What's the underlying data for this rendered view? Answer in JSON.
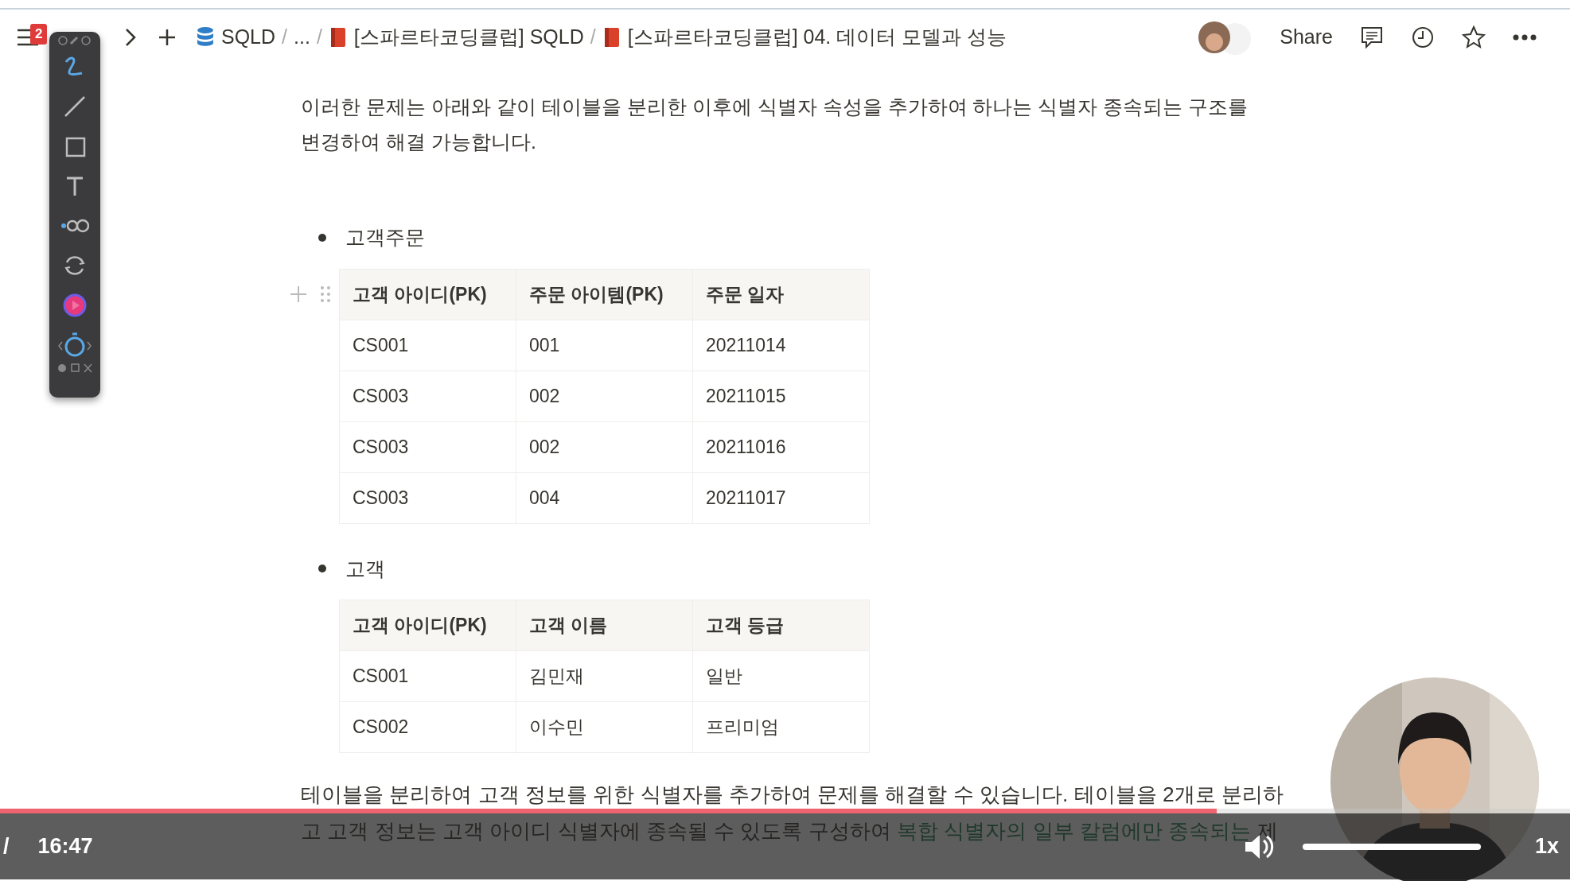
{
  "topbar": {
    "notification_count": "2",
    "breadcrumb": [
      {
        "kind": "database",
        "text": "SQLD"
      },
      {
        "kind": "separator",
        "text": "/"
      },
      {
        "kind": "plain",
        "text": "..."
      },
      {
        "kind": "separator",
        "text": "/"
      },
      {
        "kind": "page",
        "text": "[스파르타코딩클럽] SQLD"
      },
      {
        "kind": "separator",
        "text": "/"
      },
      {
        "kind": "page",
        "text": "[스파르타코딩클럽] 04. 데이터 모델과 성능"
      }
    ],
    "share": "Share"
  },
  "annotation_toolbar": {
    "tools": [
      {
        "kind": "pen",
        "selected": true
      },
      {
        "kind": "line",
        "selected": false
      },
      {
        "kind": "rectangle",
        "selected": false
      },
      {
        "kind": "text",
        "selected": false
      },
      {
        "kind": "link",
        "selected": false
      },
      {
        "kind": "rotate",
        "selected": false
      },
      {
        "kind": "record",
        "selected": false
      },
      {
        "kind": "timer",
        "selected": false
      }
    ]
  },
  "paragraph": "이러한 문제는 아래와 같이 테이블을 분리한 이후에 식별자 속성을 추가하여 하나는 식별자 종속되는 구조를 변경하여 해결 가능합니다.",
  "sections": [
    {
      "bullet": "고객주문",
      "table": {
        "columns": [
          "고객 아이디(PK)",
          "주문 아이템(PK)",
          "주문 일자"
        ],
        "rows": [
          [
            "CS001",
            "001",
            "20211014"
          ],
          [
            "CS003",
            "002",
            "20211015"
          ],
          [
            "CS003",
            "002",
            "20211016"
          ],
          [
            "CS003",
            "004",
            "20211017"
          ]
        ]
      }
    },
    {
      "bullet": "고객",
      "table": {
        "columns": [
          "고객 아이디(PK)",
          "고객 이름",
          "고객 등급"
        ],
        "rows": [
          [
            "CS001",
            "김민재",
            "일반"
          ],
          [
            "CS002",
            "이수민",
            "프리미엄"
          ]
        ]
      }
    }
  ],
  "footer_lines": [
    [
      {
        "text": "테이블을 분리하여 고객 정보를 위한 식별자를 추가하여 문제를 해결할 수 있습니다. 테이블을 2개로 분리하",
        "highlighted": false
      }
    ],
    [
      {
        "text": "고 고객 정보는 고객 아이디 식별자에 종속될 수 있도록 구성하여 ",
        "highlighted": false
      },
      {
        "text": "복합 식별자의 일부 칼럼에만 종속되는",
        "highlighted": true
      },
      {
        "text": " 제",
        "highlighted": false
      }
    ]
  ],
  "webcam": {
    "kind": "picture"
  },
  "player": {
    "separator": "/",
    "time": "16:47",
    "progress": {
      "level": 0.775
    },
    "volume": {
      "level": 1
    },
    "speed": "1x"
  }
}
